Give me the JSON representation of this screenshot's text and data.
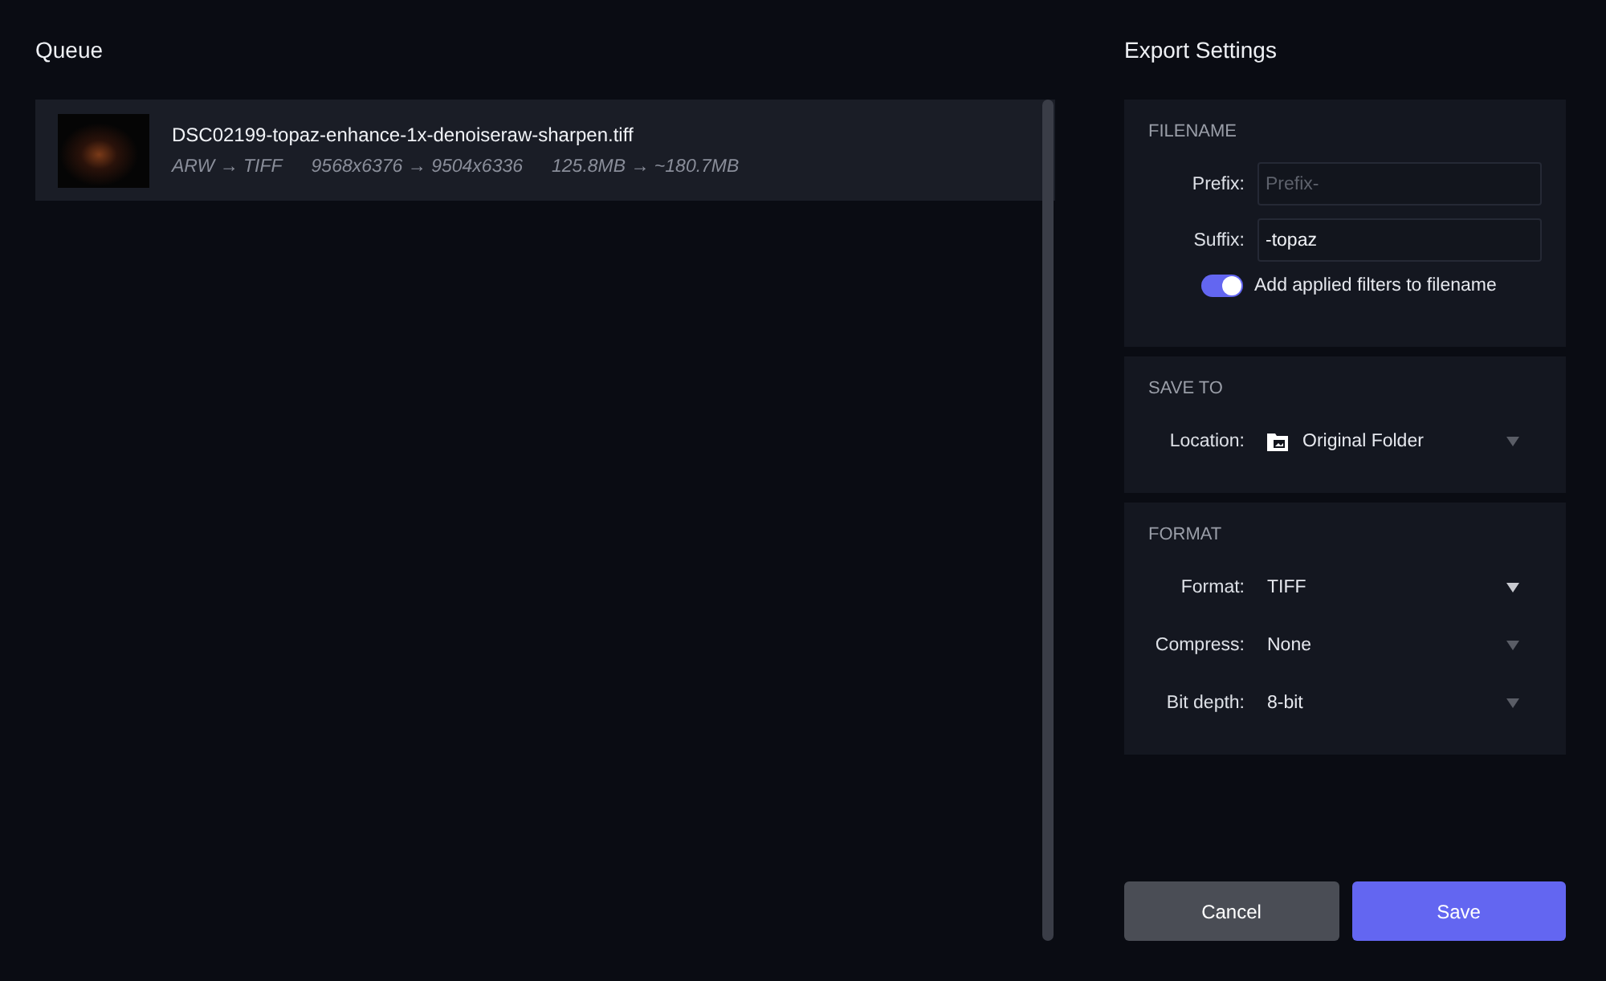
{
  "queue": {
    "title": "Queue",
    "items": [
      {
        "filename": "DSC02199-topaz-enhance-1x-denoiseraw-sharpen.tiff",
        "format": "ARW → TIFF",
        "dimensions": "9568x6376 → 9504x6336",
        "size": "125.8MB → ~180.7MB"
      }
    ]
  },
  "export_settings": {
    "title": "Export Settings",
    "filename": {
      "heading": "FILENAME",
      "prefix": {
        "label": "Prefix:",
        "placeholder": "Prefix-"
      },
      "suffix": {
        "label": "Suffix:",
        "value": "-topaz"
      },
      "toggle": {
        "label": "Add applied filters to filename",
        "on": true
      }
    },
    "save_to": {
      "heading": "SAVE TO",
      "location": {
        "label": "Location:",
        "value": "Original Folder"
      }
    },
    "format": {
      "heading": "FORMAT",
      "rows": [
        {
          "label": "Format:",
          "value": "TIFF"
        },
        {
          "label": "Compress:",
          "value": "None"
        },
        {
          "label": "Bit depth:",
          "value": "8-bit"
        }
      ]
    },
    "buttons": {
      "cancel": "Cancel",
      "save": "Save"
    }
  }
}
